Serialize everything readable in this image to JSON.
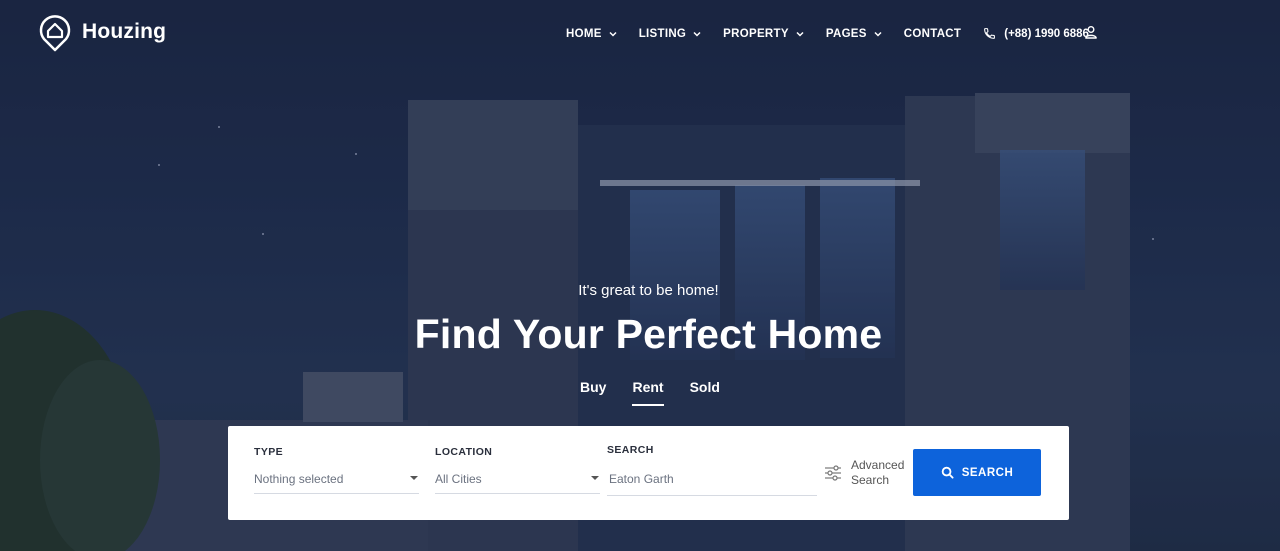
{
  "brand": {
    "name": "Houzing"
  },
  "nav": {
    "items": [
      {
        "label": "HOME",
        "has_dropdown": true
      },
      {
        "label": "LISTING",
        "has_dropdown": true
      },
      {
        "label": "PROPERTY",
        "has_dropdown": true
      },
      {
        "label": "PAGES",
        "has_dropdown": true
      },
      {
        "label": "CONTACT",
        "has_dropdown": false
      }
    ],
    "phone": "(+88) 1990 6886",
    "icons": [
      "phone-icon",
      "user-icon",
      "chevron-down-icon"
    ]
  },
  "hero": {
    "tagline": "It's great to be home!",
    "headline": "Find Your Perfect Home",
    "tabs": [
      {
        "label": "Buy",
        "active": false
      },
      {
        "label": "Rent",
        "active": true
      },
      {
        "label": "Sold",
        "active": false
      }
    ]
  },
  "search": {
    "type_label": "TYPE",
    "type_value": "Nothing selected",
    "location_label": "LOCATION",
    "location_value": "All Cities",
    "search_label": "SEARCH",
    "search_value": "Eaton Garth",
    "advanced_line1": "Advanced",
    "advanced_line2": "Search",
    "button_label": "SEARCH"
  },
  "colors": {
    "accent": "#0d63db",
    "white": "#ffffff"
  }
}
